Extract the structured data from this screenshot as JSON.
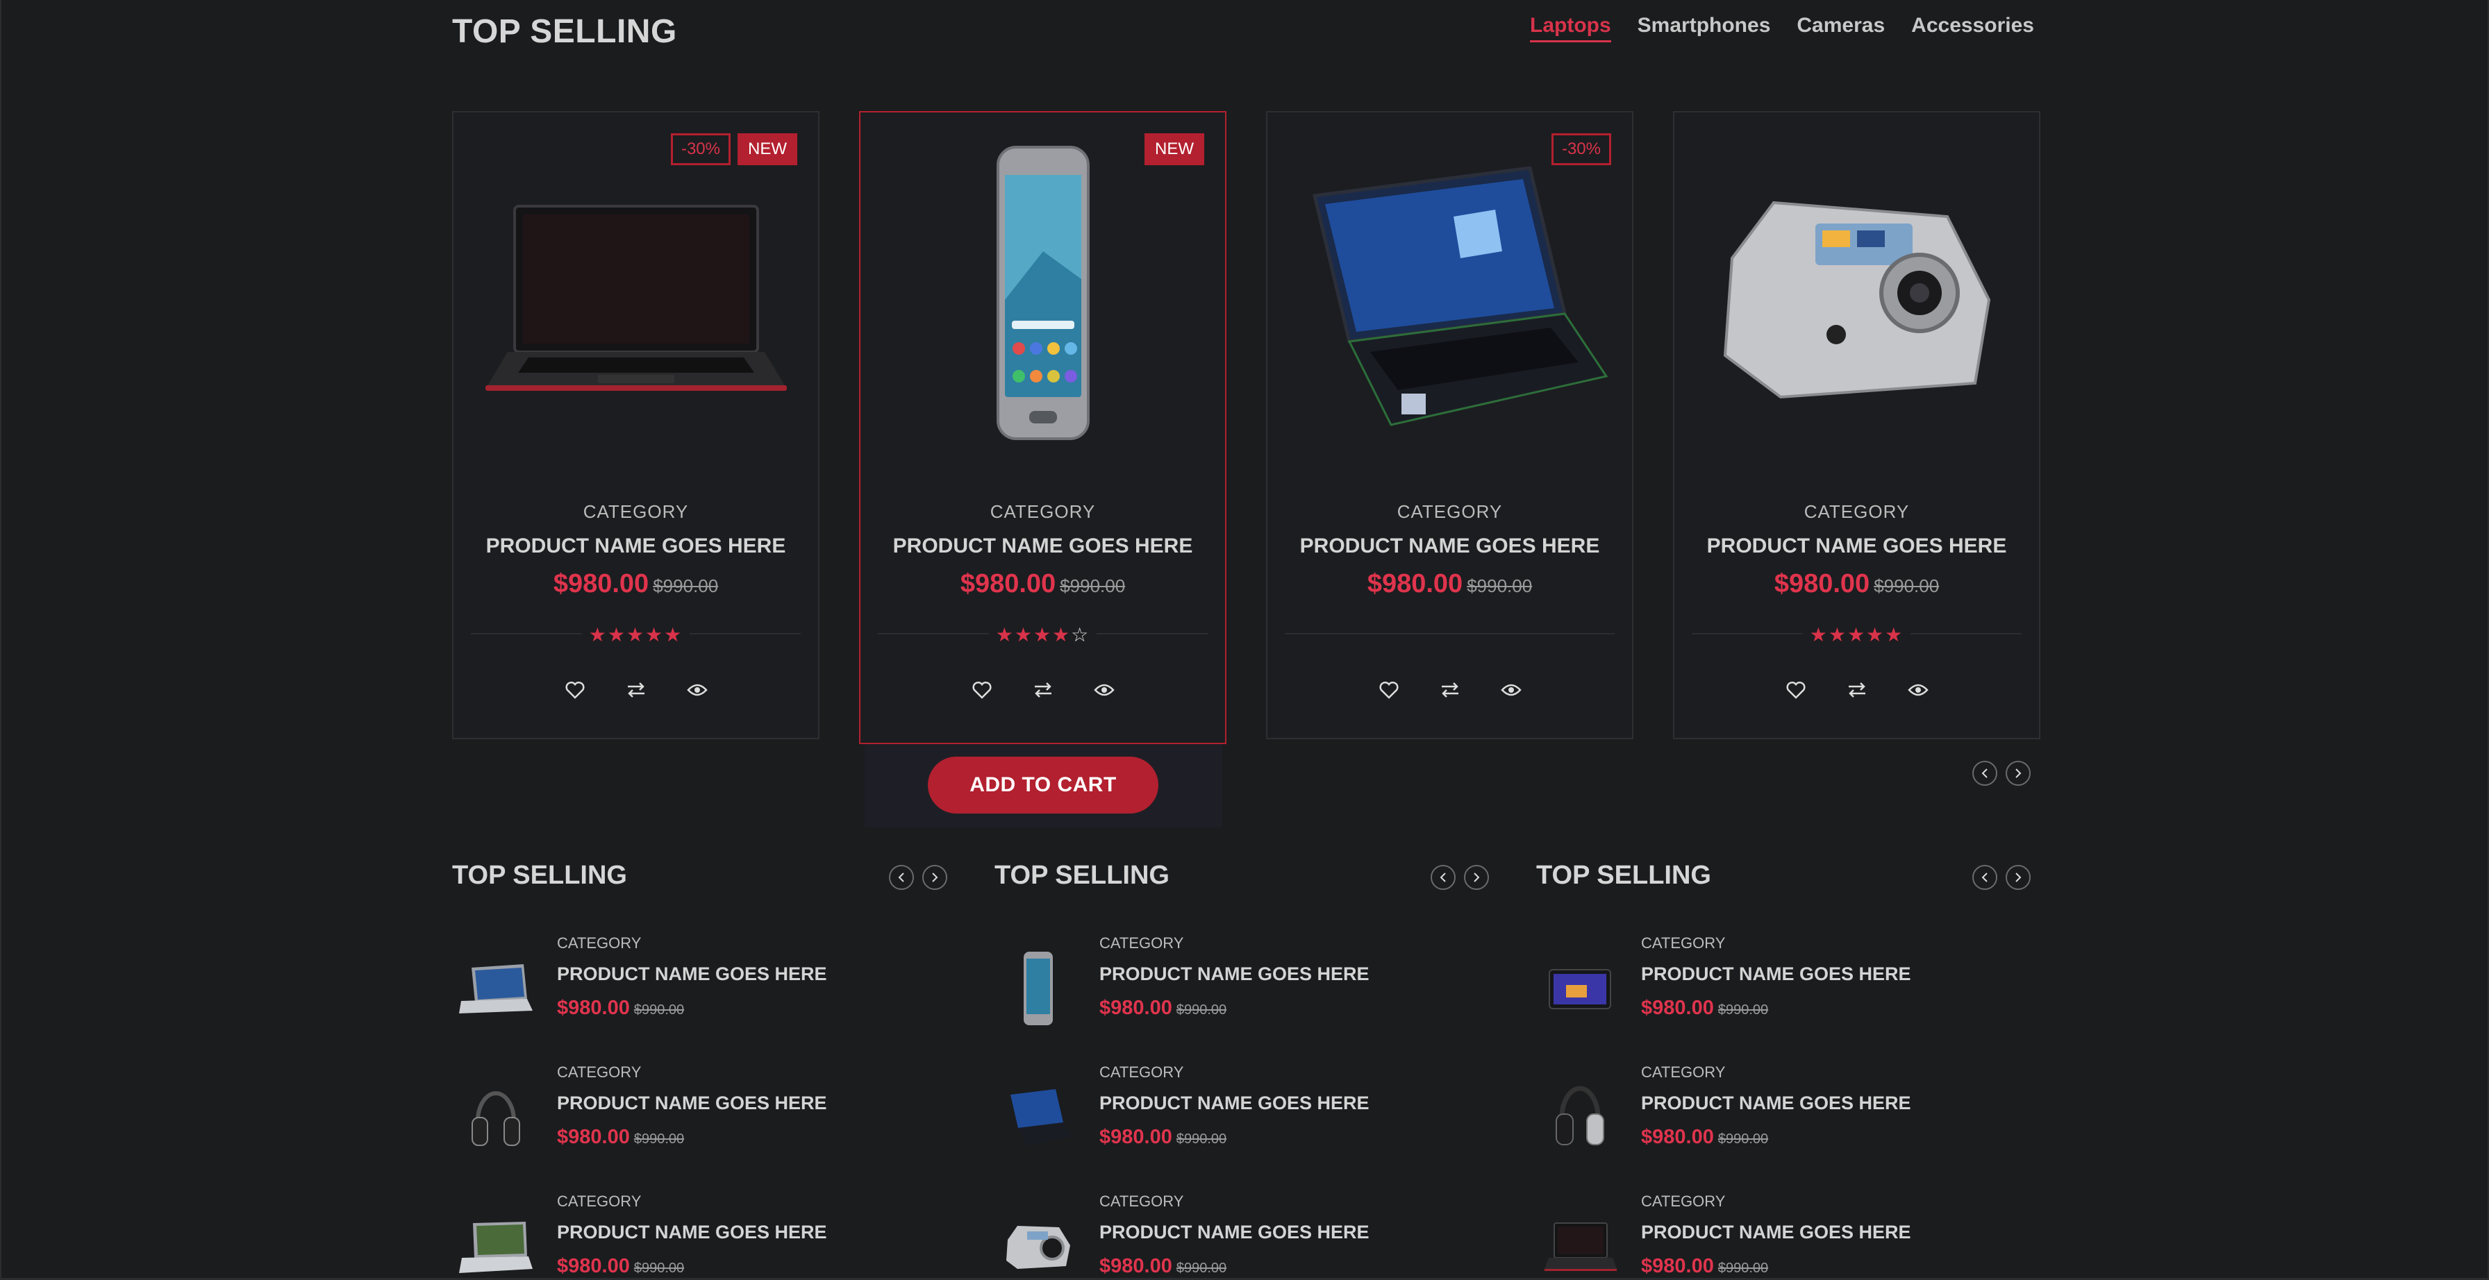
{
  "top_selling": {
    "title": "TOP SELLING",
    "tabs": [
      "Laptops",
      "Smartphones",
      "Cameras",
      "Accessories"
    ],
    "active_tab": "Laptops",
    "products": [
      {
        "category": "CATEGORY",
        "name": "PRODUCT NAME GOES HERE",
        "price": "$980.00",
        "old_price": "$990.00",
        "labels": {
          "sale": "-30%",
          "new": "NEW"
        },
        "rating": 5,
        "image": "laptop-black-red"
      },
      {
        "category": "CATEGORY",
        "name": "PRODUCT NAME GOES HERE",
        "price": "$980.00",
        "old_price": "$990.00",
        "labels": {
          "sale": "",
          "new": "NEW"
        },
        "rating": 4,
        "image": "smartphone"
      },
      {
        "category": "CATEGORY",
        "name": "PRODUCT NAME GOES HERE",
        "price": "$980.00",
        "old_price": "$990.00",
        "labels": {
          "sale": "-30%",
          "new": ""
        },
        "rating": 0,
        "image": "laptop-blue"
      },
      {
        "category": "CATEGORY",
        "name": "PRODUCT NAME GOES HERE",
        "price": "$980.00",
        "old_price": "$990.00",
        "labels": {
          "sale": "",
          "new": ""
        },
        "rating": 5,
        "image": "camera-silver"
      }
    ],
    "add_to_cart_label": "ADD TO CART",
    "icons": [
      "heart-icon",
      "exchange-icon",
      "eye-icon"
    ]
  },
  "widgets": [
    {
      "title": "TOP SELLING",
      "items": [
        {
          "category": "CATEGORY",
          "name": "PRODUCT NAME GOES HERE",
          "price": "$980.00",
          "old_price": "$990.00",
          "image": "laptop-silver"
        },
        {
          "category": "CATEGORY",
          "name": "PRODUCT NAME GOES HERE",
          "price": "$980.00",
          "old_price": "$990.00",
          "image": "headphones"
        },
        {
          "category": "CATEGORY",
          "name": "PRODUCT NAME GOES HERE",
          "price": "$980.00",
          "old_price": "$990.00",
          "image": "laptop-silver"
        }
      ]
    },
    {
      "title": "TOP SELLING",
      "items": [
        {
          "category": "CATEGORY",
          "name": "PRODUCT NAME GOES HERE",
          "price": "$980.00",
          "old_price": "$990.00",
          "image": "smartphone"
        },
        {
          "category": "CATEGORY",
          "name": "PRODUCT NAME GOES HERE",
          "price": "$980.00",
          "old_price": "$990.00",
          "image": "laptop-blue"
        },
        {
          "category": "CATEGORY",
          "name": "PRODUCT NAME GOES HERE",
          "price": "$980.00",
          "old_price": "$990.00",
          "image": "camera-silver"
        }
      ]
    },
    {
      "title": "TOP SELLING",
      "items": [
        {
          "category": "CATEGORY",
          "name": "PRODUCT NAME GOES HERE",
          "price": "$980.00",
          "old_price": "$990.00",
          "image": "tablet"
        },
        {
          "category": "CATEGORY",
          "name": "PRODUCT NAME GOES HERE",
          "price": "$980.00",
          "old_price": "$990.00",
          "image": "headphones"
        },
        {
          "category": "CATEGORY",
          "name": "PRODUCT NAME GOES HERE",
          "price": "$980.00",
          "old_price": "$990.00",
          "image": "laptop-black-red"
        }
      ]
    }
  ],
  "colors": {
    "accent": "#d8334a",
    "accent_dark": "#b3202f",
    "background": "#1b1c1e"
  }
}
